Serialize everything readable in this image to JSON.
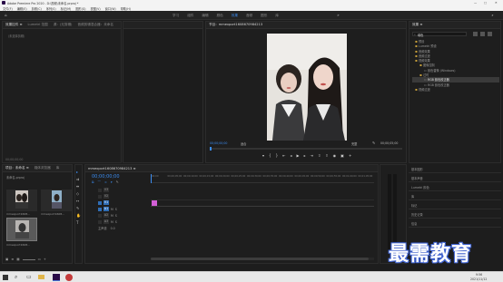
{
  "titlebar": {
    "title": "Adobe Premiere Pro 2020 - D:\\视频\\未命名.prproj *",
    "menus": [
      "文件(F)",
      "编辑(E)",
      "剪辑(C)",
      "序列(S)",
      "标记(M)",
      "图形(G)",
      "视图(V)",
      "窗口(W)",
      "帮助(H)"
    ],
    "controls": [
      "—",
      "□",
      "✕"
    ]
  },
  "workspaces": {
    "items": [
      "学习",
      "组件",
      "编辑",
      "颜色",
      "效果",
      "音频",
      "图形",
      "库"
    ],
    "active_index": 4
  },
  "source_panel": {
    "tabs": [
      "效果控件 ≡",
      "Lumetri 范围",
      "源：(无剪辑)",
      "音频剪辑混合器：未命名"
    ],
    "placeholder": "（未选择剪辑）",
    "timecode": "00;00;00;00"
  },
  "program_monitor": {
    "tab": "节目：mmexport1608670984213",
    "timecode_left": "00;00;00;00",
    "fit_label": "适合",
    "quality_label": "完整",
    "timecode_right": "00;00;05;00"
  },
  "project_panel": {
    "tabs": [
      "项目：未命名 ≡",
      "媒体浏览器",
      "库"
    ],
    "project_file": "未命名.prproj",
    "clips": [
      {
        "name": "mmexport1608...",
        "duration": "5;00"
      },
      {
        "name": "mmexport1608...",
        "duration": "5;00"
      },
      {
        "name": "mmexport1608...",
        "duration": "5;00"
      }
    ]
  },
  "timeline": {
    "tab": "mmexport1608670984213 ≡",
    "timecode": "00;00;00;00",
    "ruler": [
      "00;00",
      "00;00;05;00",
      "00;00;10;00",
      "00;00;15;00",
      "00;00;20;00",
      "00;00;25;00",
      "00;00;30;00",
      "00;00;35;00",
      "00;00;40;00",
      "00;00;45;00",
      "00;00;50;00",
      "00;00;55;00",
      "00;01;00;00",
      "00;01;05;00"
    ],
    "video_tracks": [
      "V3",
      "V2",
      "V1"
    ],
    "audio_tracks": [
      "A1",
      "A2",
      "A3"
    ],
    "master_label": "主声道",
    "master_value": "0.0"
  },
  "effects_panel": {
    "title": "效果 ≡",
    "search_value": "填色",
    "tree": [
      {
        "label": "预设",
        "indent": 0
      },
      {
        "label": "Lumetri 预设",
        "indent": 0
      },
      {
        "label": "音频效果",
        "indent": 0
      },
      {
        "label": "音频过渡",
        "indent": 0
      },
      {
        "label": "视频效果",
        "indent": 0
      },
      {
        "label": "图像控制",
        "indent": 1
      },
      {
        "label": "颜色替换 (Windows)",
        "indent": 2
      },
      {
        "label": "过时",
        "indent": 1
      },
      {
        "label": "RGB 颜色校正器",
        "indent": 2,
        "highlight": true
      },
      {
        "label": "RGB 颜色校正器",
        "indent": 2
      },
      {
        "label": "视频过渡",
        "indent": 0
      }
    ],
    "sections": [
      "基本图形",
      "基本声音",
      "Lumetri 颜色",
      "库",
      "标记",
      "历史记录",
      "信息"
    ]
  },
  "taskbar": {
    "time": "9:56",
    "date": "2021/11/12"
  },
  "watermark": "最需教育"
}
